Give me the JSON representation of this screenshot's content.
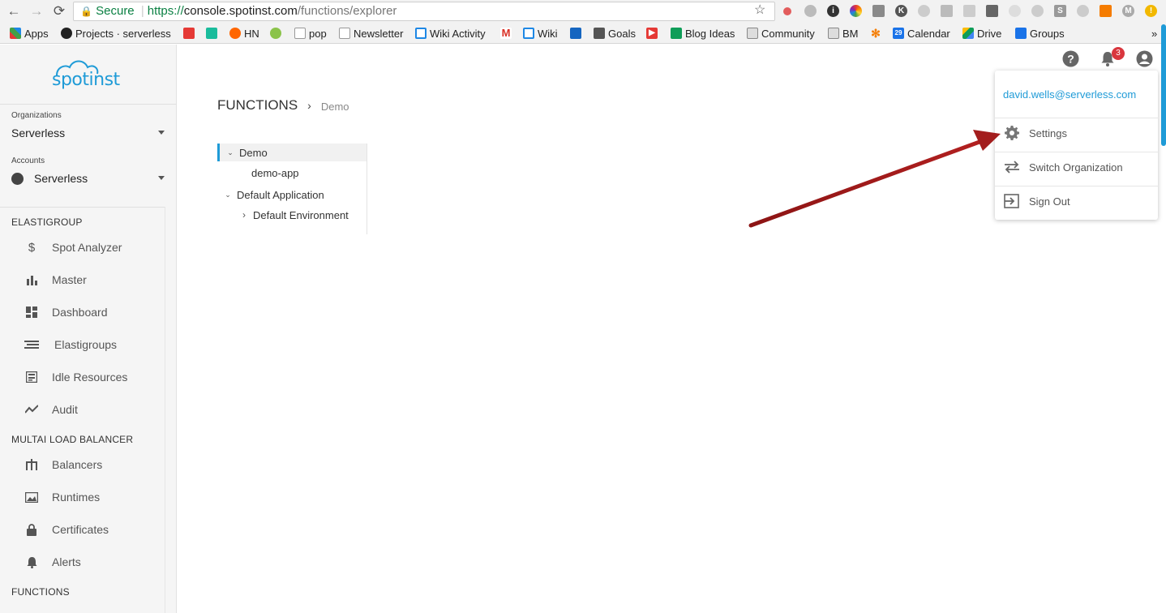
{
  "browser": {
    "secure_label": "Secure",
    "url_scheme": "https://",
    "url_host": "console.spotinst.com",
    "url_path": "/functions/explorer",
    "bookmarks": [
      "Apps",
      "Projects · serverless",
      "HN",
      "pop",
      "Newsletter",
      "Wiki Activity",
      "Wiki",
      "Goals",
      "Blog Ideas",
      "Community",
      "BM",
      "Calendar",
      "Drive",
      "Groups"
    ],
    "calendar_day": "29",
    "overflow": "»"
  },
  "sidebar": {
    "logo_text": "spotinst",
    "organizations_label": "Organizations",
    "organization_value": "Serverless",
    "accounts_label": "Accounts",
    "account_value": "Serverless",
    "sections": [
      {
        "title": "ELASTIGROUP",
        "items": [
          {
            "label": "Spot Analyzer",
            "icon": "dollar-icon"
          },
          {
            "label": "Master",
            "icon": "bar-chart-icon"
          },
          {
            "label": "Dashboard",
            "icon": "dashboard-icon"
          },
          {
            "label": "Elastigroups",
            "icon": "elastigroups-icon"
          },
          {
            "label": "Idle Resources",
            "icon": "idle-resources-icon"
          },
          {
            "label": "Audit",
            "icon": "trend-line-icon"
          }
        ]
      },
      {
        "title": "MULTAI LOAD BALANCER",
        "items": [
          {
            "label": "Balancers",
            "icon": "balancers-icon"
          },
          {
            "label": "Runtimes",
            "icon": "runtimes-icon"
          },
          {
            "label": "Certificates",
            "icon": "lock-icon"
          },
          {
            "label": "Alerts",
            "icon": "bell-icon"
          }
        ]
      },
      {
        "title": "FUNCTIONS",
        "items": []
      }
    ]
  },
  "main": {
    "breadcrumb_root": "FUNCTIONS",
    "breadcrumb_sep": "›",
    "breadcrumb_current": "Demo",
    "tree": [
      {
        "label": "Demo",
        "level": 0,
        "expanded": true,
        "active": true
      },
      {
        "label": "demo-app",
        "level": 1
      },
      {
        "label": "Default Application",
        "level": 0,
        "expanded": true
      },
      {
        "label": "Default Environment",
        "level": 1,
        "expanded": false
      }
    ]
  },
  "header": {
    "notification_count": "3"
  },
  "user_menu": {
    "email": "david.wells@serverless.com",
    "items": [
      {
        "label": "Settings",
        "icon": "gear-icon"
      },
      {
        "label": "Switch Organization",
        "icon": "swap-arrows-icon"
      },
      {
        "label": "Sign Out",
        "icon": "sign-out-icon"
      }
    ]
  },
  "colors": {
    "accent": "#1f9bd7",
    "badge": "#d9363e",
    "annotation_arrow": "#a31d1d"
  }
}
